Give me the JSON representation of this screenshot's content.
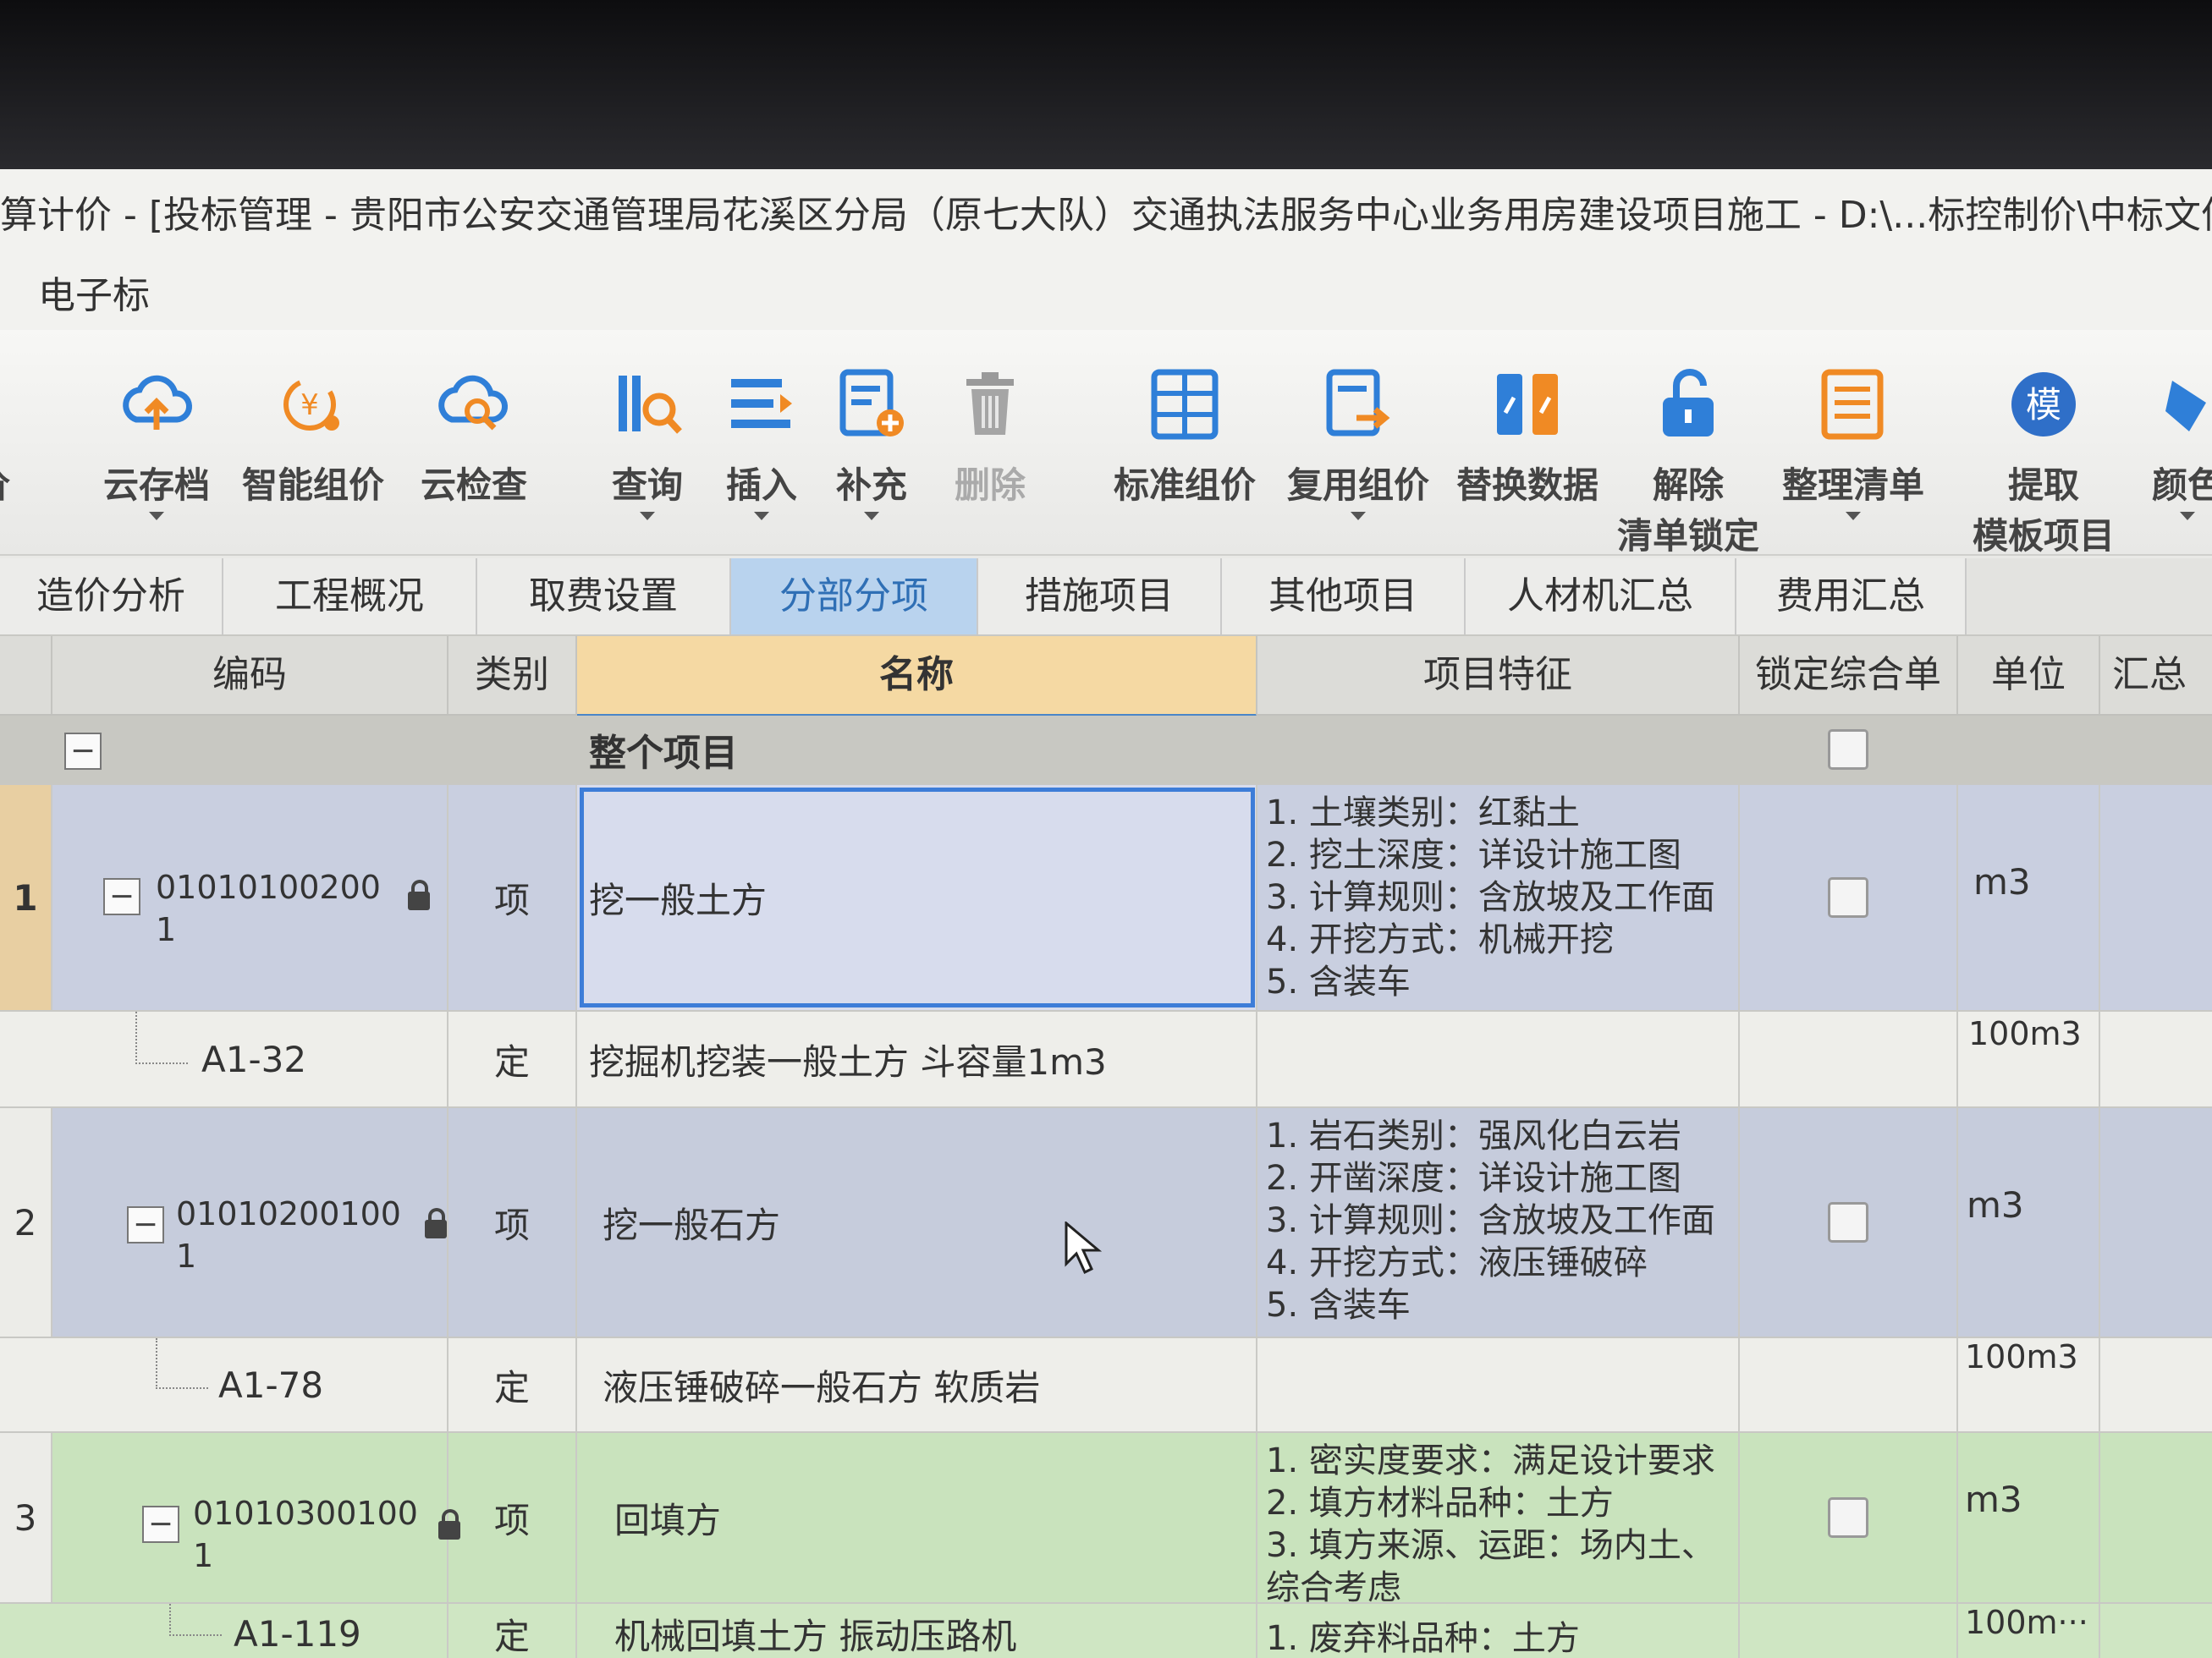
{
  "window": {
    "title": "算计价 - [投标管理 - 贵阳市公安交通管理局花溪区分局（原七大队）交通执法服务中心业务用房建设项目施工 - D:\\...标控制价\\中标文件"
  },
  "menu": {
    "item": "电子标"
  },
  "toolbar": {
    "items": [
      {
        "label": "价",
        "icon": "partial-icon"
      },
      {
        "label": "云存档",
        "icon": "cloud-upload-icon",
        "dropdown": true
      },
      {
        "label": "智能组价",
        "icon": "smart-pricing-icon"
      },
      {
        "label": "云检查",
        "icon": "cloud-search-icon"
      },
      {
        "label": "查询",
        "icon": "query-icon",
        "dropdown": true
      },
      {
        "label": "插入",
        "icon": "insert-list-icon",
        "dropdown": true
      },
      {
        "label": "补充",
        "icon": "supplement-icon",
        "dropdown": true
      },
      {
        "label": "删除",
        "icon": "trash-icon",
        "disabled": true
      },
      {
        "label": "标准组价",
        "icon": "standard-pricing-icon"
      },
      {
        "label": "复用组价",
        "icon": "reuse-pricing-icon",
        "dropdown": true
      },
      {
        "label": "替换数据",
        "icon": "replace-data-icon"
      },
      {
        "label": "解除",
        "label2": "清单锁定",
        "icon": "unlock-icon"
      },
      {
        "label": "整理清单",
        "icon": "organize-list-icon",
        "dropdown": true
      },
      {
        "label": "提取",
        "label2": "模板项目",
        "icon": "template-icon",
        "icon_text": "模"
      },
      {
        "label": "颜色",
        "icon": "color-icon",
        "dropdown": true
      }
    ]
  },
  "tabs": [
    "造价分析",
    "工程概况",
    "取费设置",
    "分部分项",
    "措施项目",
    "其他项目",
    "人材机汇总",
    "费用汇总"
  ],
  "active_tab": "分部分项",
  "table": {
    "headers": {
      "code": "编码",
      "type": "类别",
      "name": "名称",
      "feature": "项目特征",
      "lock_price": "锁定综合单价",
      "unit": "单位",
      "total": "汇总"
    },
    "root": {
      "name": "整个项目"
    },
    "rows": [
      {
        "index": "1",
        "code_line1": "01010100200",
        "code_line2": "1",
        "type": "项",
        "name": "挖一般土方",
        "features": [
          "1. 土壤类别：红黏土",
          "2. 挖土深度：详设计施工图",
          "3. 计算规则：含放坡及工作面",
          "4. 开挖方式：机械开挖",
          "5. 含装车"
        ],
        "unit": "m3",
        "sub": {
          "code": "A1-32",
          "type": "定",
          "name": "挖掘机挖装一般土方 斗容量1m3",
          "unit": "100m3"
        }
      },
      {
        "index": "2",
        "code_line1": "01010200100",
        "code_line2": "1",
        "type": "项",
        "name": "挖一般石方",
        "features": [
          "1. 岩石类别：强风化白云岩",
          "2. 开凿深度：详设计施工图",
          "3. 计算规则：含放坡及工作面",
          "4. 开挖方式：液压锤破碎",
          "5. 含装车"
        ],
        "unit": "m3",
        "sub": {
          "code": "A1-78",
          "type": "定",
          "name": "液压锤破碎一般石方 软质岩",
          "unit": "100m3"
        }
      },
      {
        "index": "3",
        "code_line1": "01010300100",
        "code_line2": "1",
        "type": "项",
        "name": "回填方",
        "features": [
          "1. 密实度要求：满足设计要求",
          "2. 填方材料品种：土方",
          "3. 填方来源、运距：场内土、",
          "综合考虑"
        ],
        "unit": "m3",
        "sub": {
          "code": "A1-119",
          "type": "定",
          "name": "机械回填土方 振动压路机",
          "unit": "100m···",
          "features": [
            "1. 废弃料品种：土方"
          ]
        }
      }
    ]
  },
  "colors": {
    "row1": "#c9cfe0",
    "row2": "#c6ccdc",
    "row3": "#c9e3bd",
    "sub": "#eeeeea",
    "selected_header": "#f5d9a3",
    "accent": "#3d7dd8"
  }
}
